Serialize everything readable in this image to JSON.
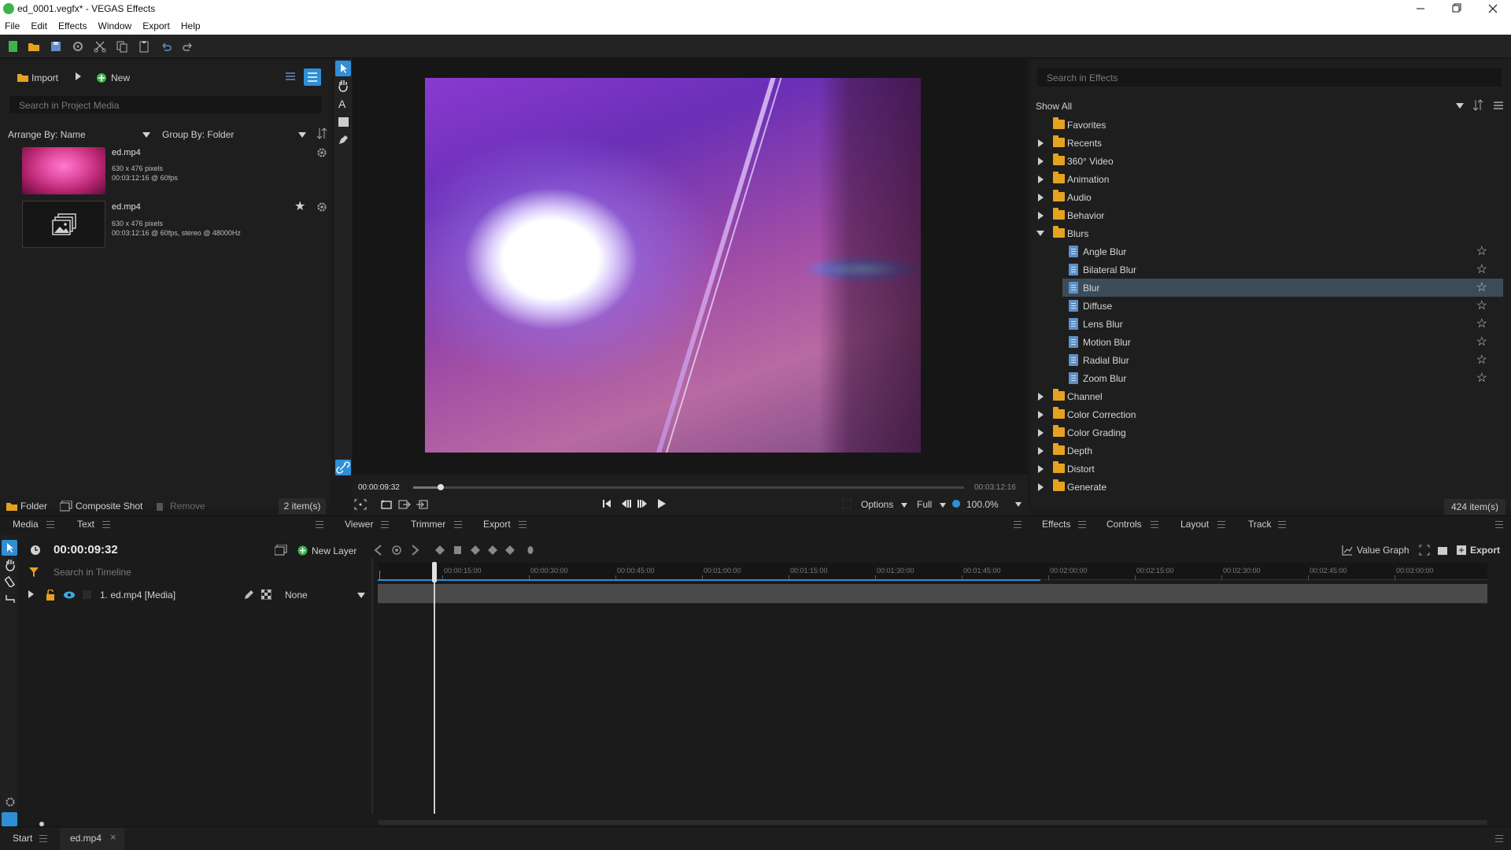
{
  "window": {
    "title": "ed_0001.vegfx* - VEGAS Effects"
  },
  "menu": [
    "File",
    "Edit",
    "Effects",
    "Window",
    "Export",
    "Help"
  ],
  "media_panel": {
    "import_label": "Import",
    "new_label": "New",
    "search_placeholder": "Search in Project Media",
    "arrange_label": "Arrange By: Name",
    "group_label": "Group By: Folder",
    "items": [
      {
        "name": "ed.mp4",
        "line1": "630 x 476 pixels",
        "line2": "00:03:12:16 @ 60fps"
      },
      {
        "name": "ed.mp4",
        "line1": "630 x 476 pixels",
        "line2": "00:03:12:16 @ 60fps, stereo @ 48000Hz"
      }
    ],
    "folder_label": "Folder",
    "composite_label": "Composite Shot",
    "remove_label": "Remove",
    "count_label": "2 item(s)",
    "tabs": [
      "Media",
      "Text"
    ]
  },
  "viewer": {
    "current_time": "00:00:09:32",
    "end_time": "00:03:12:16",
    "progress": 0.05,
    "options_label": "Options",
    "quality_label": "Full",
    "zoom_label": "100.0%",
    "tabs": [
      "Viewer",
      "Trimmer",
      "Export"
    ]
  },
  "effects_panel": {
    "search_placeholder": "Search in Effects",
    "filter_label": "Show All",
    "count_label": "424 item(s)",
    "tabs": [
      "Effects",
      "Controls",
      "Layout",
      "Track"
    ],
    "tree": [
      {
        "label": "Favorites",
        "type": "folder",
        "arrow": "none"
      },
      {
        "label": "Recents",
        "type": "folder",
        "arrow": "right"
      },
      {
        "label": "360° Video",
        "type": "folder",
        "arrow": "right"
      },
      {
        "label": "Animation",
        "type": "folder",
        "arrow": "right"
      },
      {
        "label": "Audio",
        "type": "folder",
        "arrow": "right"
      },
      {
        "label": "Behavior",
        "type": "folder",
        "arrow": "right"
      },
      {
        "label": "Blurs",
        "type": "folder",
        "arrow": "down"
      },
      {
        "label": "Angle Blur",
        "type": "file"
      },
      {
        "label": "Bilateral Blur",
        "type": "file"
      },
      {
        "label": "Blur",
        "type": "file",
        "selected": true
      },
      {
        "label": "Diffuse",
        "type": "file"
      },
      {
        "label": "Lens Blur",
        "type": "file"
      },
      {
        "label": "Motion Blur",
        "type": "file"
      },
      {
        "label": "Radial Blur",
        "type": "file"
      },
      {
        "label": "Zoom Blur",
        "type": "file"
      },
      {
        "label": "Channel",
        "type": "folder",
        "arrow": "right"
      },
      {
        "label": "Color Correction",
        "type": "folder",
        "arrow": "right"
      },
      {
        "label": "Color Grading",
        "type": "folder",
        "arrow": "right"
      },
      {
        "label": "Depth",
        "type": "folder",
        "arrow": "right"
      },
      {
        "label": "Distort",
        "type": "folder",
        "arrow": "right"
      },
      {
        "label": "Generate",
        "type": "folder",
        "arrow": "right"
      }
    ]
  },
  "timeline": {
    "time": "00:00:09:32",
    "new_layer_label": "New Layer",
    "search_placeholder": "Search in Timeline",
    "value_graph_label": "Value Graph",
    "export_label": "Export",
    "layer_name": "1. ed.mp4 [Media]",
    "blend_label": "None",
    "ruler": [
      "00:00:15:00",
      "00:00:30:00",
      "00:00:45:00",
      "00:01:00:00",
      "00:01:15:00",
      "00:01:30:00",
      "00:01:45:00",
      "00:02:00:00",
      "00:02:15:00",
      "00:02:30:00",
      "00:02:45:00",
      "00:03:00:00"
    ]
  },
  "bottom_tabs": [
    "Start",
    "ed.mp4"
  ],
  "colors": {
    "accent": "#2f8fd6",
    "folder": "#e5a221",
    "selection": "#3c4b58",
    "app_icon": "#3cb44b"
  }
}
